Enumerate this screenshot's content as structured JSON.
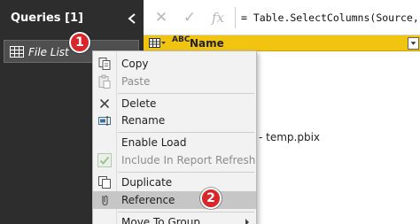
{
  "queries_pane": {
    "title": "Queries [1]",
    "query_items": [
      {
        "label": "File List",
        "icon": "table-icon"
      }
    ],
    "colors": {
      "background": "#2d2d2d",
      "item_background": "#4f4f4f"
    }
  },
  "formula_bar": {
    "cancel_symbol": "✕",
    "commit_symbol": "✓",
    "fx_symbol": "fx",
    "formula_text": "= Table.SelectColumns(Source,{\"Nam"
  },
  "grid": {
    "column_header": {
      "type_icon": "ABC",
      "name": "Name"
    },
    "visible_cell_text": "- temp.pbix",
    "colors": {
      "header_background": "#f1c40f"
    }
  },
  "context_menu": {
    "items": [
      {
        "label": "Copy",
        "icon": "copy-icon",
        "disabled": false
      },
      {
        "label": "Paste",
        "icon": "paste-icon",
        "disabled": true
      },
      {
        "label": "Delete",
        "icon": "delete-icon",
        "disabled": false
      },
      {
        "label": "Rename",
        "icon": "rename-icon",
        "disabled": false
      },
      {
        "label": "Enable Load",
        "icon": "",
        "disabled": false
      },
      {
        "label": "Include In Report Refresh",
        "icon": "checkbox-checked-icon",
        "disabled": true
      },
      {
        "label": "Duplicate",
        "icon": "duplicate-icon",
        "disabled": false
      },
      {
        "label": "Reference",
        "icon": "reference-icon",
        "disabled": false,
        "highlighted": true
      },
      {
        "label": "Move To Group",
        "icon": "",
        "disabled": false,
        "has_submenu": true
      }
    ],
    "colors": {
      "background": "#f2f2f2",
      "highlight": "#c6c6c6"
    }
  },
  "annotations": {
    "badge_1": "1",
    "badge_2": "2",
    "badge_color": "#d8262b"
  }
}
